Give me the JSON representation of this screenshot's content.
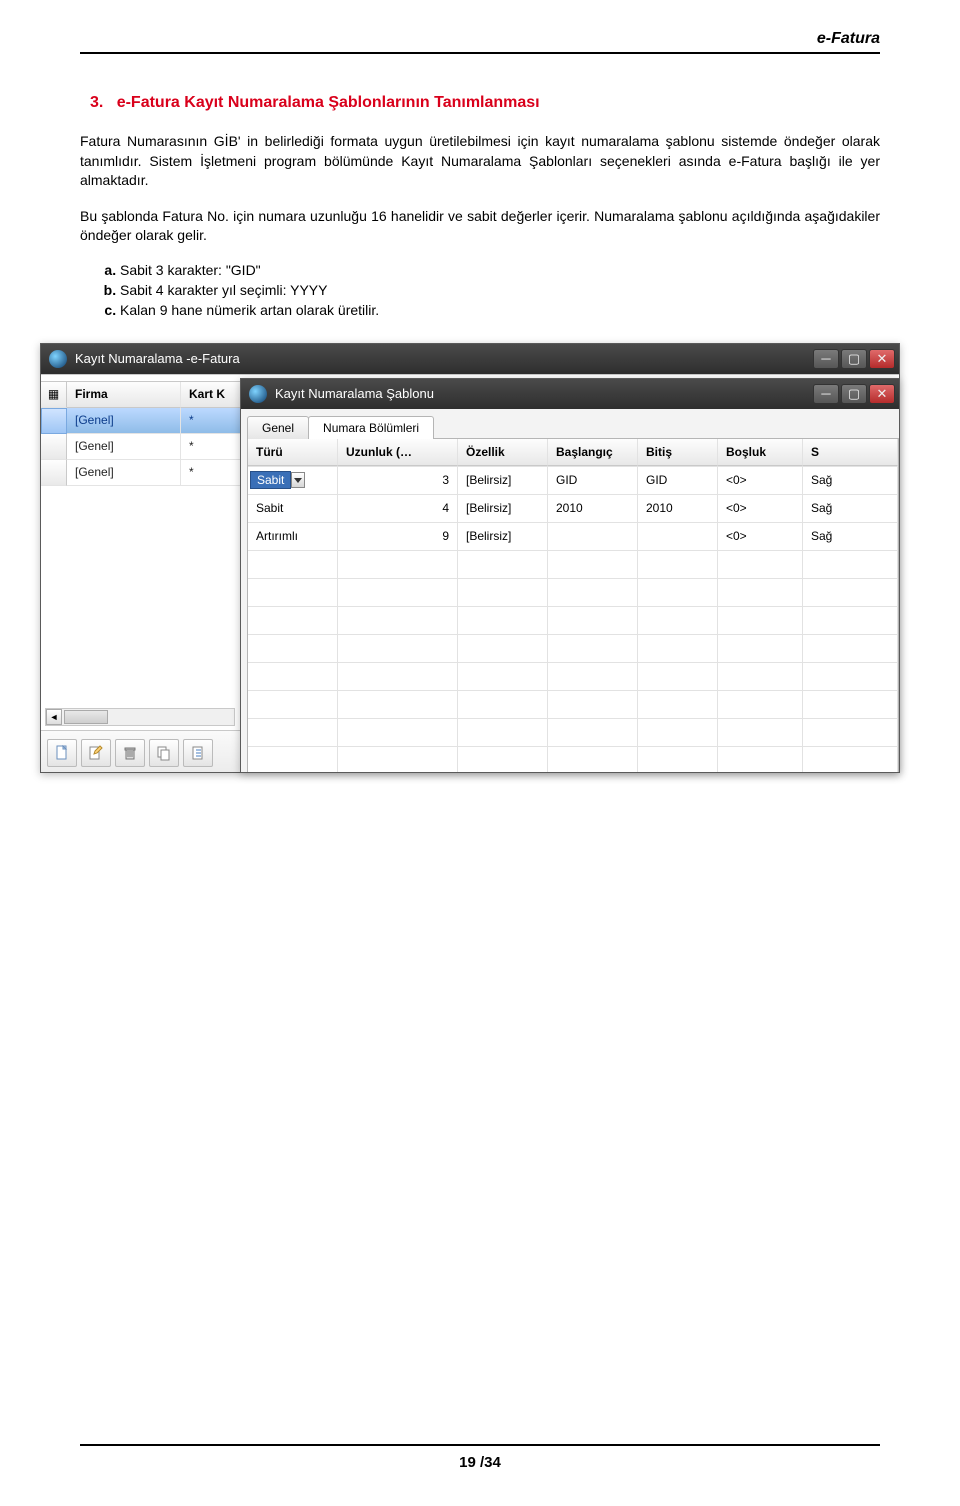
{
  "header": {
    "title": "e-Fatura"
  },
  "section": {
    "num": "3.",
    "title": "e-Fatura Kayıt Numaralama Şablonlarının Tanımlanması"
  },
  "para1": "Fatura Numarasının GİB' in belirlediği formata uygun üretilebilmesi için kayıt numaralama şablonu sistemde öndeğer olarak tanımlıdır. Sistem İşletmeni program bölümünde Kayıt Numaralama Şablonları seçenekleri asında e-Fatura  başlığı ile yer almaktadır.",
  "para2": "Bu şablonda Fatura No. için numara uzunluğu 16 hanelidir ve sabit değerler içerir. Numaralama şablonu açıldığında aşağıdakiler öndeğer olarak gelir.",
  "list": {
    "a": "Sabit 3 karakter: \"GID\"",
    "b": "Sabit 4 karakter yıl seçimli: YYYY",
    "c": "Kalan 9 hane nümerik artan olarak üretilir."
  },
  "outerWin": {
    "title": "Kayıt Numaralama -e-Fatura",
    "cols": {
      "c1": "Firma",
      "c2": "Kart K"
    },
    "rows": [
      {
        "firma": "[Genel]",
        "kart": "*"
      },
      {
        "firma": "[Genel]",
        "kart": "*"
      },
      {
        "firma": "[Genel]",
        "kart": "*"
      }
    ]
  },
  "innerWin": {
    "title": "Kayıt Numaralama Şablonu",
    "tabs": {
      "t1": "Genel",
      "t2": "Numara Bölümleri"
    },
    "cols": {
      "turu": "Türü",
      "uzun": "Uzunluk (…",
      "ozel": "Özellik",
      "bas": "Başlangıç",
      "bit": "Bitiş",
      "bos": "Boşluk",
      "s": "S"
    },
    "rows": [
      {
        "turu": "Sabit",
        "uzun": "3",
        "ozel": "[Belirsiz]",
        "bas": "GID",
        "bit": "GID",
        "bos": "<0>",
        "s": "Sağ"
      },
      {
        "turu": "Sabit",
        "uzun": "4",
        "ozel": "[Belirsiz]",
        "bas": "2010",
        "bit": "2010",
        "bos": "<0>",
        "s": "Sağ"
      },
      {
        "turu": "Artırımlı",
        "uzun": "9",
        "ozel": "[Belirsiz]",
        "bas": "",
        "bit": "",
        "bos": "<0>",
        "s": "Sağ"
      }
    ]
  },
  "footer": {
    "page": "19 /34"
  }
}
